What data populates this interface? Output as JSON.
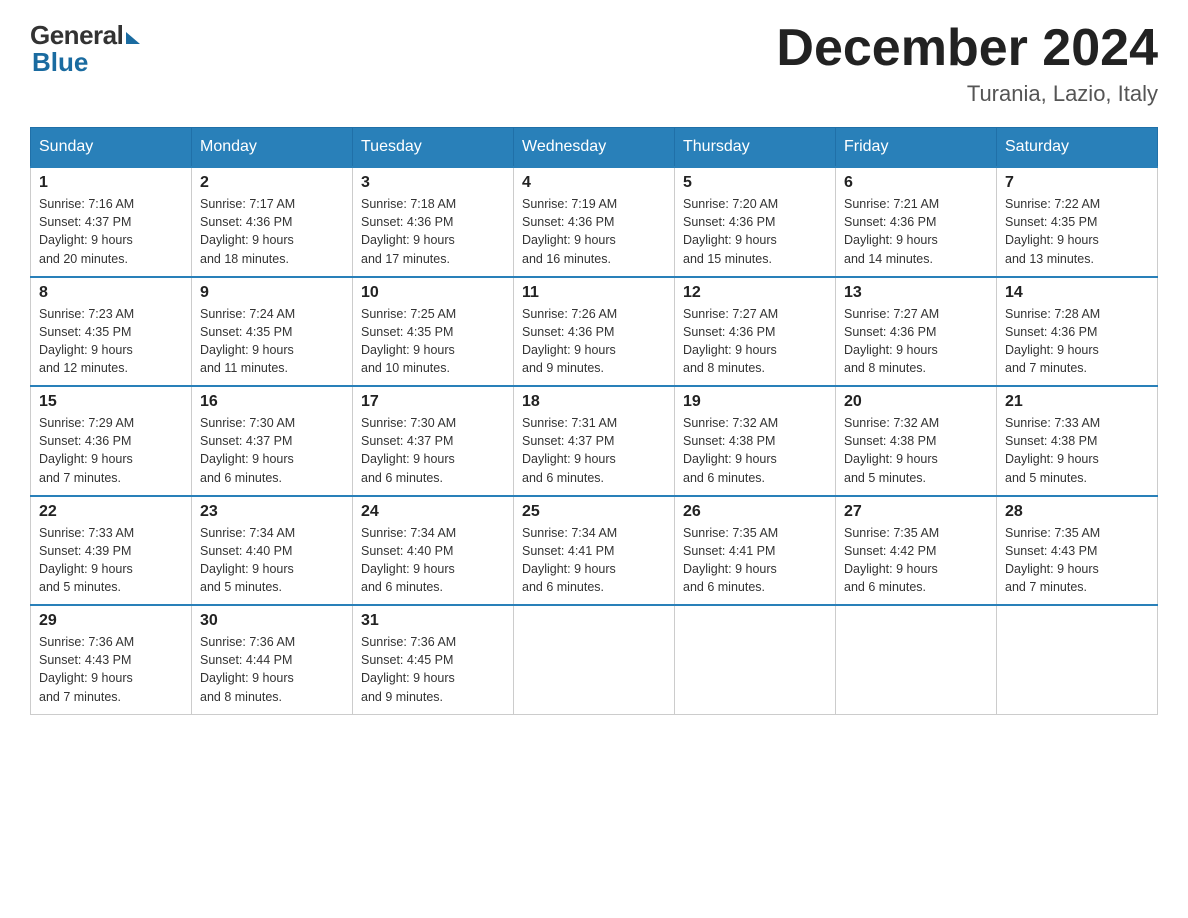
{
  "logo": {
    "general": "General",
    "blue": "Blue"
  },
  "header": {
    "month_year": "December 2024",
    "location": "Turania, Lazio, Italy"
  },
  "weekdays": [
    "Sunday",
    "Monday",
    "Tuesday",
    "Wednesday",
    "Thursday",
    "Friday",
    "Saturday"
  ],
  "weeks": [
    [
      {
        "day": "1",
        "sunrise": "7:16 AM",
        "sunset": "4:37 PM",
        "daylight": "9 hours and 20 minutes."
      },
      {
        "day": "2",
        "sunrise": "7:17 AM",
        "sunset": "4:36 PM",
        "daylight": "9 hours and 18 minutes."
      },
      {
        "day": "3",
        "sunrise": "7:18 AM",
        "sunset": "4:36 PM",
        "daylight": "9 hours and 17 minutes."
      },
      {
        "day": "4",
        "sunrise": "7:19 AM",
        "sunset": "4:36 PM",
        "daylight": "9 hours and 16 minutes."
      },
      {
        "day": "5",
        "sunrise": "7:20 AM",
        "sunset": "4:36 PM",
        "daylight": "9 hours and 15 minutes."
      },
      {
        "day": "6",
        "sunrise": "7:21 AM",
        "sunset": "4:36 PM",
        "daylight": "9 hours and 14 minutes."
      },
      {
        "day": "7",
        "sunrise": "7:22 AM",
        "sunset": "4:35 PM",
        "daylight": "9 hours and 13 minutes."
      }
    ],
    [
      {
        "day": "8",
        "sunrise": "7:23 AM",
        "sunset": "4:35 PM",
        "daylight": "9 hours and 12 minutes."
      },
      {
        "day": "9",
        "sunrise": "7:24 AM",
        "sunset": "4:35 PM",
        "daylight": "9 hours and 11 minutes."
      },
      {
        "day": "10",
        "sunrise": "7:25 AM",
        "sunset": "4:35 PM",
        "daylight": "9 hours and 10 minutes."
      },
      {
        "day": "11",
        "sunrise": "7:26 AM",
        "sunset": "4:36 PM",
        "daylight": "9 hours and 9 minutes."
      },
      {
        "day": "12",
        "sunrise": "7:27 AM",
        "sunset": "4:36 PM",
        "daylight": "9 hours and 8 minutes."
      },
      {
        "day": "13",
        "sunrise": "7:27 AM",
        "sunset": "4:36 PM",
        "daylight": "9 hours and 8 minutes."
      },
      {
        "day": "14",
        "sunrise": "7:28 AM",
        "sunset": "4:36 PM",
        "daylight": "9 hours and 7 minutes."
      }
    ],
    [
      {
        "day": "15",
        "sunrise": "7:29 AM",
        "sunset": "4:36 PM",
        "daylight": "9 hours and 7 minutes."
      },
      {
        "day": "16",
        "sunrise": "7:30 AM",
        "sunset": "4:37 PM",
        "daylight": "9 hours and 6 minutes."
      },
      {
        "day": "17",
        "sunrise": "7:30 AM",
        "sunset": "4:37 PM",
        "daylight": "9 hours and 6 minutes."
      },
      {
        "day": "18",
        "sunrise": "7:31 AM",
        "sunset": "4:37 PM",
        "daylight": "9 hours and 6 minutes."
      },
      {
        "day": "19",
        "sunrise": "7:32 AM",
        "sunset": "4:38 PM",
        "daylight": "9 hours and 6 minutes."
      },
      {
        "day": "20",
        "sunrise": "7:32 AM",
        "sunset": "4:38 PM",
        "daylight": "9 hours and 5 minutes."
      },
      {
        "day": "21",
        "sunrise": "7:33 AM",
        "sunset": "4:38 PM",
        "daylight": "9 hours and 5 minutes."
      }
    ],
    [
      {
        "day": "22",
        "sunrise": "7:33 AM",
        "sunset": "4:39 PM",
        "daylight": "9 hours and 5 minutes."
      },
      {
        "day": "23",
        "sunrise": "7:34 AM",
        "sunset": "4:40 PM",
        "daylight": "9 hours and 5 minutes."
      },
      {
        "day": "24",
        "sunrise": "7:34 AM",
        "sunset": "4:40 PM",
        "daylight": "9 hours and 6 minutes."
      },
      {
        "day": "25",
        "sunrise": "7:34 AM",
        "sunset": "4:41 PM",
        "daylight": "9 hours and 6 minutes."
      },
      {
        "day": "26",
        "sunrise": "7:35 AM",
        "sunset": "4:41 PM",
        "daylight": "9 hours and 6 minutes."
      },
      {
        "day": "27",
        "sunrise": "7:35 AM",
        "sunset": "4:42 PM",
        "daylight": "9 hours and 6 minutes."
      },
      {
        "day": "28",
        "sunrise": "7:35 AM",
        "sunset": "4:43 PM",
        "daylight": "9 hours and 7 minutes."
      }
    ],
    [
      {
        "day": "29",
        "sunrise": "7:36 AM",
        "sunset": "4:43 PM",
        "daylight": "9 hours and 7 minutes."
      },
      {
        "day": "30",
        "sunrise": "7:36 AM",
        "sunset": "4:44 PM",
        "daylight": "9 hours and 8 minutes."
      },
      {
        "day": "31",
        "sunrise": "7:36 AM",
        "sunset": "4:45 PM",
        "daylight": "9 hours and 9 minutes."
      },
      null,
      null,
      null,
      null
    ]
  ],
  "labels": {
    "sunrise": "Sunrise:",
    "sunset": "Sunset:",
    "daylight": "Daylight:"
  }
}
